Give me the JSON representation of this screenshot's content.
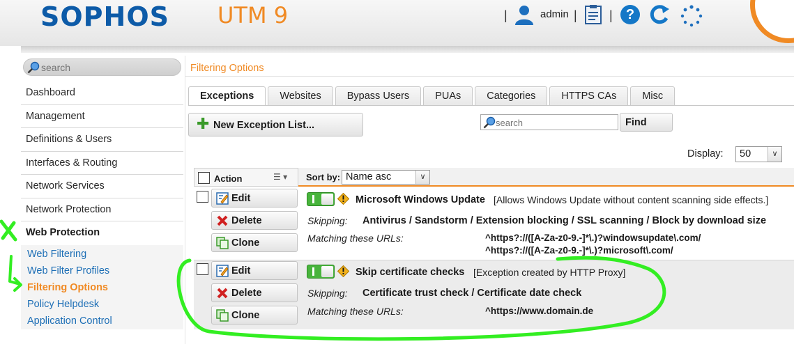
{
  "header": {
    "brand": "SOPHOS",
    "product": "UTM 9",
    "separator": "|",
    "user_label": "admin",
    "help_glyph": "?",
    "icons": [
      "user-icon",
      "live-log-icon",
      "help-icon",
      "reload-icon",
      "busy-indicator-icon"
    ]
  },
  "sidebar": {
    "search_placeholder": "search",
    "items": [
      {
        "label": "Dashboard"
      },
      {
        "label": "Management"
      },
      {
        "label": "Definitions & Users"
      },
      {
        "label": "Interfaces & Routing"
      },
      {
        "label": "Network Services"
      },
      {
        "label": "Network Protection"
      },
      {
        "label": "Web Protection"
      }
    ],
    "subitems": [
      {
        "label": "Web Filtering"
      },
      {
        "label": "Web Filter Profiles"
      },
      {
        "label": "Filtering Options"
      },
      {
        "label": "Policy Helpdesk"
      },
      {
        "label": "Application Control"
      }
    ]
  },
  "main": {
    "breadcrumb": "Filtering Options",
    "tabs": [
      {
        "label": "Exceptions"
      },
      {
        "label": "Websites"
      },
      {
        "label": "Bypass Users"
      },
      {
        "label": "PUAs"
      },
      {
        "label": "Categories"
      },
      {
        "label": "HTTPS CAs"
      },
      {
        "label": "Misc"
      }
    ],
    "new_button": "New Exception List...",
    "search_placeholder": "search",
    "find_button": "Find",
    "display_label": "Display:",
    "display_value": "50",
    "list_header": {
      "action_label": "Action",
      "sort_label": "Sort by:",
      "sort_value": "Name asc"
    },
    "row_buttons": {
      "edit": "Edit",
      "delete": "Delete",
      "clone": "Clone"
    },
    "skipping_label": "Skipping:",
    "matching_label": "Matching these URLs:",
    "exceptions": [
      {
        "name": "Microsoft Windows Update",
        "description": "[Allows Windows Update without content scanning side effects.]",
        "skipping": "Antivirus / Sandstorm / Extension blocking / SSL scanning / Block by download size",
        "urls": [
          "^https?://([A-Za-z0-9.-]*\\.)?windowsupdate\\.com/",
          "^https?://([A-Za-z0-9.-]*\\.)?microsoft\\.com/"
        ]
      },
      {
        "name": "Skip certificate checks",
        "description": "[Exception created by HTTP Proxy]",
        "skipping": "Certificate trust check / Certificate date check",
        "urls": [
          "^https://www.domain.de"
        ]
      }
    ]
  },
  "colors": {
    "brand_blue": "#0d5ba8",
    "accent_orange": "#f08a24",
    "link_blue": "#1e6fb6",
    "toggle_green": "#48b43c",
    "annotation_green": "#33ee22"
  }
}
